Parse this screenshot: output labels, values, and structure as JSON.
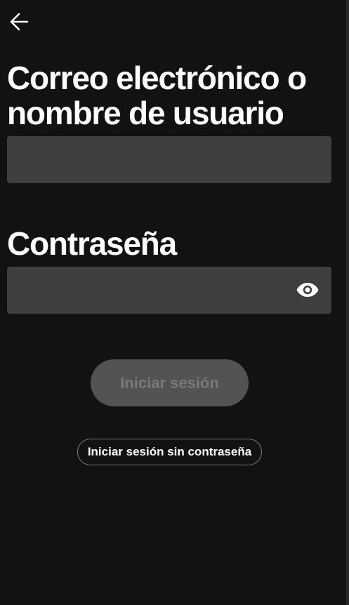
{
  "header": {
    "back_icon": "arrow-left-icon"
  },
  "form": {
    "email_label": "Correo electrónico o nombre de usuario",
    "email_value": "",
    "password_label": "Contraseña",
    "password_value": "",
    "show_password_icon": "eye-icon"
  },
  "actions": {
    "login_label": "Iniciar sesión",
    "login_enabled": false,
    "login_without_password_label": "Iniciar sesión sin contraseña"
  },
  "colors": {
    "background": "#121212",
    "field_background": "#3e3e3e",
    "disabled_button": "#535353",
    "disabled_text": "#797979",
    "text": "#ffffff"
  }
}
